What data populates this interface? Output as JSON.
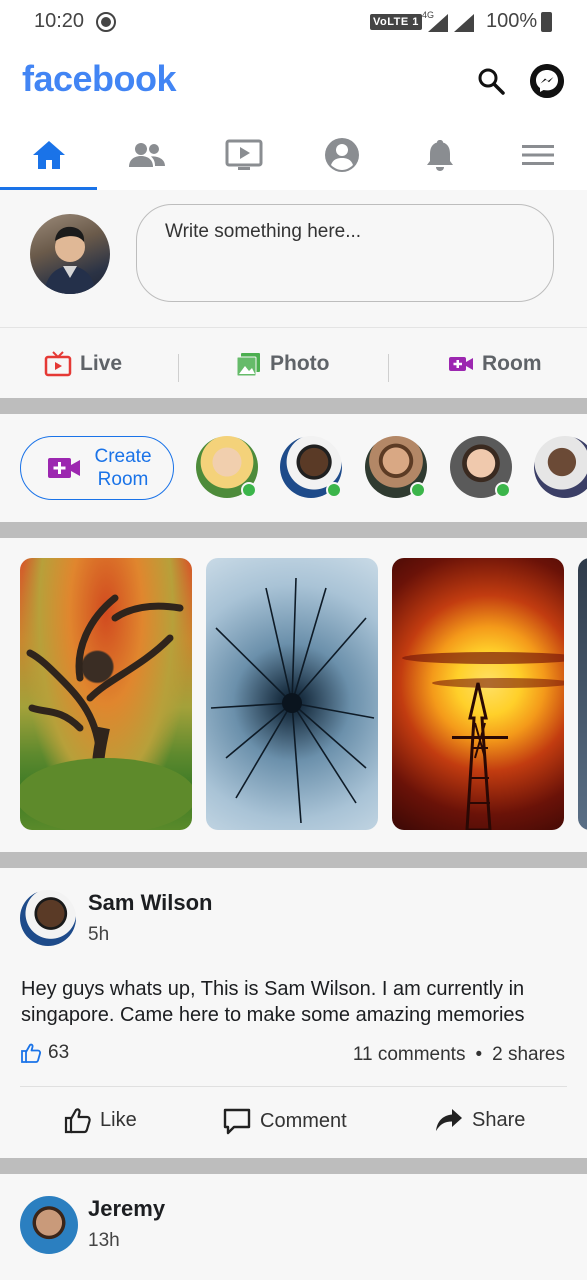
{
  "status_bar": {
    "time": "10:20",
    "volte": "VoLTE 1",
    "network": "4G",
    "battery": "100%"
  },
  "header": {
    "logo": "facebook",
    "brand_color": "#4285f4",
    "icons": [
      "search-icon",
      "messenger-icon"
    ]
  },
  "nav": {
    "tabs": [
      "home",
      "friends",
      "watch",
      "profile",
      "notifications",
      "menu"
    ],
    "active": "home",
    "accent": "#1a73e8"
  },
  "composer": {
    "placeholder": "Write something here..."
  },
  "actions": {
    "live": "Live",
    "photo": "Photo",
    "room": "Room",
    "colors": {
      "live": "#e53935",
      "photo": "#4caf50",
      "room": "#9c27b0"
    }
  },
  "rooms": {
    "create_label_line1": "Create",
    "create_label_line2": "Room",
    "online_color": "#3bb54a"
  },
  "posts": [
    {
      "author": "Sam Wilson",
      "time": "5h",
      "text": "Hey guys whats up, This is Sam Wilson. I am currently in singapore. Came here to make some amazing memories",
      "likes": "63",
      "comments": "11 comments",
      "separator": "•",
      "shares": "2 shares",
      "like_label": "Like",
      "comment_label": "Comment",
      "share_label": "Share"
    },
    {
      "author": "Jeremy",
      "time": "13h"
    }
  ]
}
